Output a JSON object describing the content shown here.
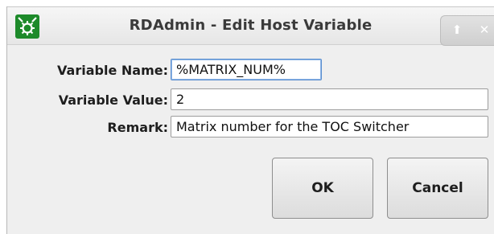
{
  "window": {
    "title": "RDAdmin - Edit Host Variable",
    "icon": "rdadmin-app-icon",
    "controls": {
      "maximize_glyph": "⬆",
      "close_glyph": "✕"
    }
  },
  "form": {
    "variable_name_label": "Variable Name:",
    "variable_name_value": "%MATRIX_NUM%",
    "variable_value_label": "Variable Value:",
    "variable_value_value": "2",
    "remark_label": "Remark:",
    "remark_value": "Matrix number for the TOC Switcher"
  },
  "buttons": {
    "ok_label": "OK",
    "cancel_label": "Cancel"
  },
  "colors": {
    "icon_green": "#1d8a2a",
    "focus_border": "#5b8fd0",
    "background": "#efefef"
  }
}
